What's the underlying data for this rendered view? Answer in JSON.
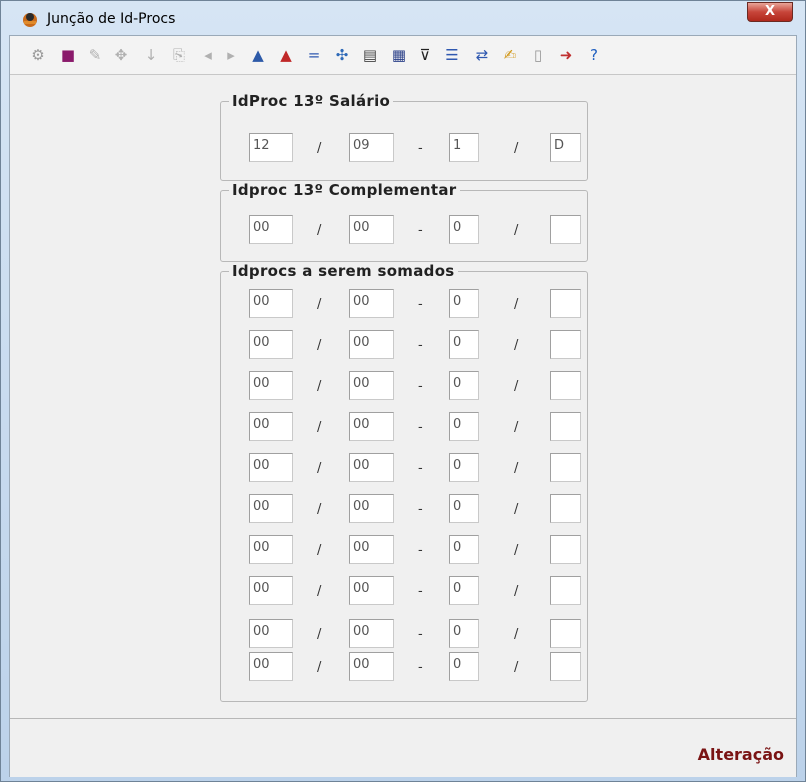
{
  "window": {
    "title": "Junção de Id-Procs",
    "close_label": "X"
  },
  "toolbar": {
    "buttons": [
      {
        "name": "gear-icon",
        "glyph": "⚙",
        "color": "#9a9a9a",
        "enabled": false
      },
      {
        "name": "save-icon",
        "glyph": "■",
        "color": "#8a1a6b",
        "enabled": true
      },
      {
        "name": "edit-icon",
        "glyph": "✎",
        "color": "#b0b0b0",
        "enabled": false
      },
      {
        "name": "tools-icon",
        "glyph": "✥",
        "color": "#b0b0b0",
        "enabled": false
      },
      {
        "name": "arrow-down-icon",
        "glyph": "↓",
        "color": "#b0b0b0",
        "enabled": false
      },
      {
        "name": "preview-icon",
        "glyph": "⎘",
        "color": "#b0b0b0",
        "enabled": false
      },
      {
        "name": "previous-icon",
        "glyph": "◂",
        "color": "#b0b0b0",
        "enabled": false
      },
      {
        "name": "next-icon",
        "glyph": "▸",
        "color": "#b0b0b0",
        "enabled": false
      },
      {
        "name": "sort-asc-icon",
        "glyph": "▲",
        "color": "#2d5aa8",
        "enabled": true
      },
      {
        "name": "sort-desc-icon",
        "glyph": "▲",
        "color": "#c02828",
        "enabled": true
      },
      {
        "name": "equals-icon",
        "glyph": "=",
        "color": "#2f58b0",
        "enabled": true
      },
      {
        "name": "move-icon",
        "glyph": "✣",
        "color": "#2f6ab8",
        "enabled": true
      },
      {
        "name": "list-icon",
        "glyph": "▤",
        "color": "#444444",
        "enabled": true
      },
      {
        "name": "grid-icon",
        "glyph": "▦",
        "color": "#2a3f88",
        "enabled": true
      },
      {
        "name": "filter-icon",
        "glyph": "⊽",
        "color": "#222222",
        "enabled": true
      },
      {
        "name": "form-icon",
        "glyph": "☰",
        "color": "#2f58b0",
        "enabled": true
      },
      {
        "name": "refresh-icon",
        "glyph": "⇄",
        "color": "#2f58b0",
        "enabled": true
      },
      {
        "name": "write-icon",
        "glyph": "✍",
        "color": "#d29a20",
        "enabled": true
      },
      {
        "name": "document-icon",
        "glyph": "▯",
        "color": "#9a9a9a",
        "enabled": false
      },
      {
        "name": "exit-icon",
        "glyph": "➜",
        "color": "#c03030",
        "enabled": true
      },
      {
        "name": "help-icon",
        "glyph": "?",
        "color": "#1f5fc0",
        "enabled": true
      }
    ]
  },
  "groups": {
    "salario": {
      "legend": "IdProc 13º Salário",
      "row": {
        "a": "12",
        "b": "09",
        "c": "1",
        "d": "D"
      }
    },
    "complementar": {
      "legend": "Idproc 13º Complementar",
      "row": {
        "a": "00",
        "b": "00",
        "c": "0",
        "d": ""
      }
    },
    "somados": {
      "legend": "Idprocs a serem somados",
      "rows": [
        {
          "a": "00",
          "b": "00",
          "c": "0",
          "d": ""
        },
        {
          "a": "00",
          "b": "00",
          "c": "0",
          "d": ""
        },
        {
          "a": "00",
          "b": "00",
          "c": "0",
          "d": ""
        },
        {
          "a": "00",
          "b": "00",
          "c": "0",
          "d": ""
        },
        {
          "a": "00",
          "b": "00",
          "c": "0",
          "d": ""
        },
        {
          "a": "00",
          "b": "00",
          "c": "0",
          "d": ""
        },
        {
          "a": "00",
          "b": "00",
          "c": "0",
          "d": ""
        },
        {
          "a": "00",
          "b": "00",
          "c": "0",
          "d": ""
        },
        {
          "a": "00",
          "b": "00",
          "c": "0",
          "d": ""
        },
        {
          "a": "00",
          "b": "00",
          "c": "0",
          "d": ""
        }
      ]
    }
  },
  "separators": {
    "slash": "/",
    "dash": "-"
  },
  "status": {
    "mode": "Alteração"
  }
}
